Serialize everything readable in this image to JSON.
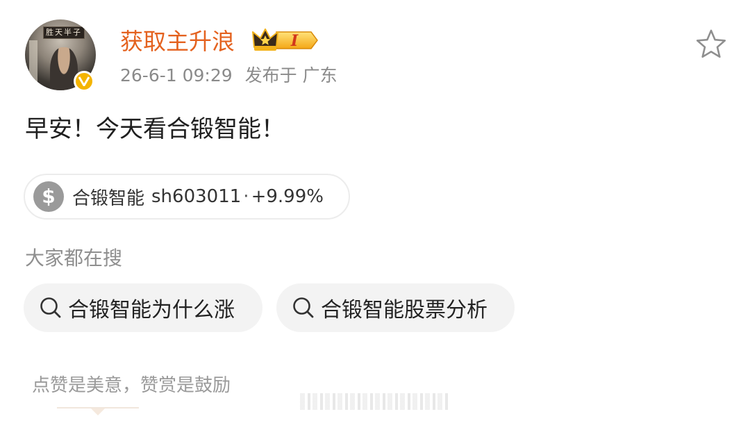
{
  "header": {
    "username": "获取主升浪",
    "badge_level": "I",
    "timestamp": "26-6-1 09:29",
    "location": "发布于 广东",
    "avatar_plaque": "胜天半子"
  },
  "post": {
    "text": "早安！今天看合锻智能！"
  },
  "stock_tag": {
    "icon": "$",
    "name": "合锻智能",
    "code": "sh603011",
    "separator": "·",
    "change": "+9.99%"
  },
  "trending": {
    "label": "大家都在搜",
    "queries": [
      {
        "text": "合锻智能为什么涨"
      },
      {
        "text": "合锻智能股票分析"
      }
    ]
  },
  "footer": {
    "reward_prompt": "点赞是美意，赞赏是鼓励"
  },
  "icons": {
    "favorite": "star-outline-icon",
    "search": "search-icon",
    "verified": "verified-v-icon",
    "badge": "crown-badge-icon"
  },
  "colors": {
    "username": "#e4621f",
    "verified": "#f4b400",
    "meta": "#8a8a8a",
    "pill_bg": "#f3f3f3"
  }
}
